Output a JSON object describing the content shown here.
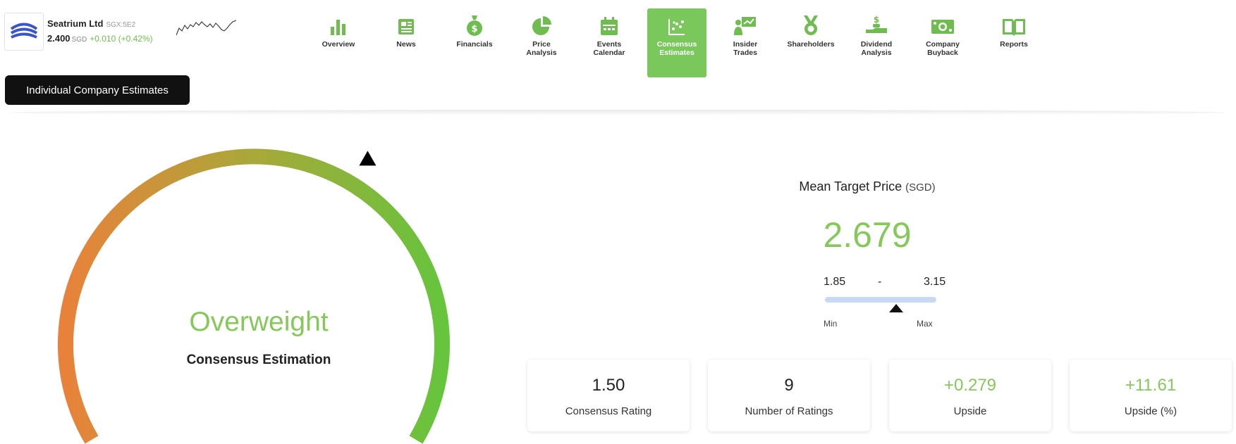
{
  "stock": {
    "name": "Seatrium Ltd",
    "exchange": "SGX:5E2",
    "price": "2.400",
    "currency": "SGD",
    "change": "+0.010 (+0.42%)"
  },
  "nav": [
    {
      "label": "Overview",
      "icon": "bar-chart-icon"
    },
    {
      "label": "News",
      "icon": "newspaper-icon"
    },
    {
      "label": "Financials",
      "icon": "money-bag-icon"
    },
    {
      "label": "Price\nAnalysis",
      "icon": "pie-chart-icon"
    },
    {
      "label": "Events\nCalendar",
      "icon": "calendar-icon"
    },
    {
      "label": "Consensus\nEstimates",
      "icon": "consensus-icon",
      "active": true
    },
    {
      "label": "Insider\nTrades",
      "icon": "presenter-icon"
    },
    {
      "label": "Shareholders",
      "icon": "medal-icon"
    },
    {
      "label": "Dividend\nAnalysis",
      "icon": "dividend-hand-icon"
    },
    {
      "label": "Company\nBuyback",
      "icon": "cash-icon"
    },
    {
      "label": "Reports",
      "icon": "book-icon"
    }
  ],
  "tab": {
    "label": "Individual Company Estimates"
  },
  "consensus": {
    "rating_word": "Overweight",
    "rating_caption": "Consensus Estimation",
    "gauge_position": 0.78
  },
  "target": {
    "title": "Mean Target Price",
    "unit": "(SGD)",
    "value": "2.679",
    "low": "1.85",
    "separator": "-",
    "high": "3.15",
    "min_label": "Min",
    "max_label": "Max",
    "marker_value": 2.679
  },
  "stats": [
    {
      "value": "1.50",
      "caption": "Consensus Rating"
    },
    {
      "value": "9",
      "caption": "Number of Ratings"
    },
    {
      "value": "+0.279",
      "caption": "Upside",
      "accent": true
    },
    {
      "value": "+11.61",
      "caption": "Upside (%)",
      "accent": true
    }
  ],
  "colors": {
    "accent": "#7ac75c",
    "positive_text": "#86c95a",
    "gauge_start": "#e8823a",
    "gauge_end": "#66c43d"
  }
}
